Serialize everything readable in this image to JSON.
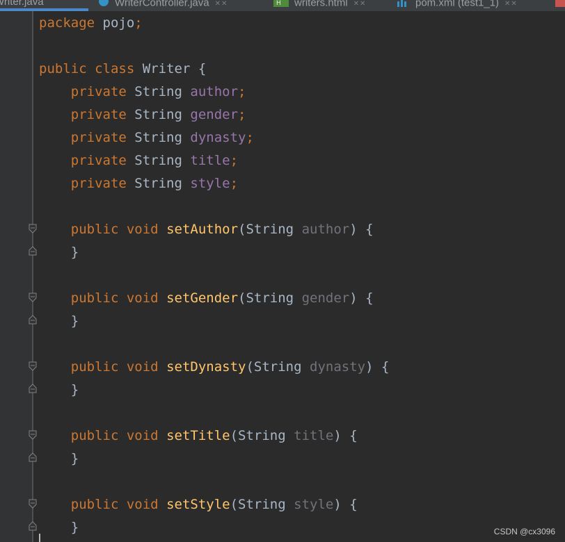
{
  "tabs": [
    {
      "label": "Writer.java",
      "icon": "class-icon",
      "active": true
    },
    {
      "label": "WriterController.java",
      "icon": "class-icon",
      "active": false
    },
    {
      "label": "writers.html",
      "icon": "html-icon",
      "active": false
    },
    {
      "label": "pom.xml (test1_1)",
      "icon": "maven-icon",
      "active": false
    }
  ],
  "code": {
    "package_kw": "package",
    "package_name": "pojo",
    "semi": ";",
    "public_kw": "public",
    "class_kw": "class",
    "class_name": "Writer",
    "open_brace": "{",
    "close_brace": "}",
    "private_kw": "private",
    "void_kw": "void",
    "string_type": "String",
    "fields": [
      "author",
      "gender",
      "dynasty",
      "title",
      "style"
    ],
    "methods": [
      {
        "name": "setAuthor",
        "param": "author"
      },
      {
        "name": "setGender",
        "param": "gender"
      },
      {
        "name": "setDynasty",
        "param": "dynasty"
      },
      {
        "name": "setTitle",
        "param": "title"
      },
      {
        "name": "setStyle",
        "param": "style"
      }
    ]
  },
  "colors": {
    "background": "#2b2b2b",
    "keyword": "#cc7832",
    "method": "#ffc66d",
    "field": "#9876aa",
    "param": "#72737a",
    "text": "#a9b7c6"
  },
  "watermark": "CSDN @cx3096"
}
